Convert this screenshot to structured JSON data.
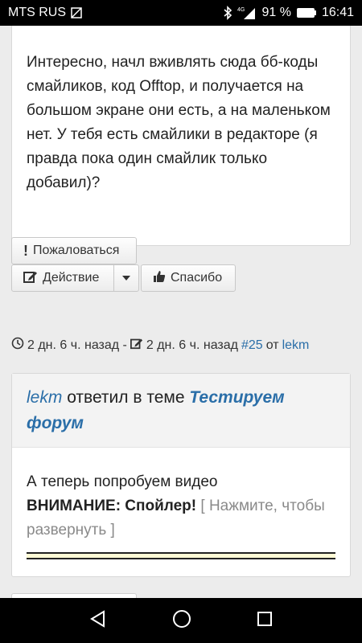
{
  "status_bar": {
    "carrier": "MTS RUS",
    "battery": "91 %",
    "time": "16:41",
    "network": "4G"
  },
  "post1": {
    "text": "Интересно, начл вживлять сюда бб-коды смайликов, код Offtop, и получается на большом экране они есть, а на маленьком нет. У тебя есть смайлики в редакторе (я правда пока один смайлик только добавил)?"
  },
  "actions": {
    "report": "Пожаловаться",
    "action": "Действие",
    "thanks": "Спасибо"
  },
  "meta": {
    "posted": "2 дн. 6 ч. назад -",
    "edited": "2 дн. 6 ч. назад",
    "post_number": "#25",
    "from": "от",
    "author": "lekm"
  },
  "post2": {
    "user": "lekm",
    "replied": "ответил в теме",
    "topic": "Тестируем форум",
    "line1": "А теперь попробуем видео",
    "warning": "ВНИМАНИЕ: Спойлер!",
    "spoiler_hint": "[ Нажмите, чтобы развернуть ]"
  },
  "colors": {
    "link": "#2a6ea8",
    "spoiler_bg": "#fffbd6"
  }
}
